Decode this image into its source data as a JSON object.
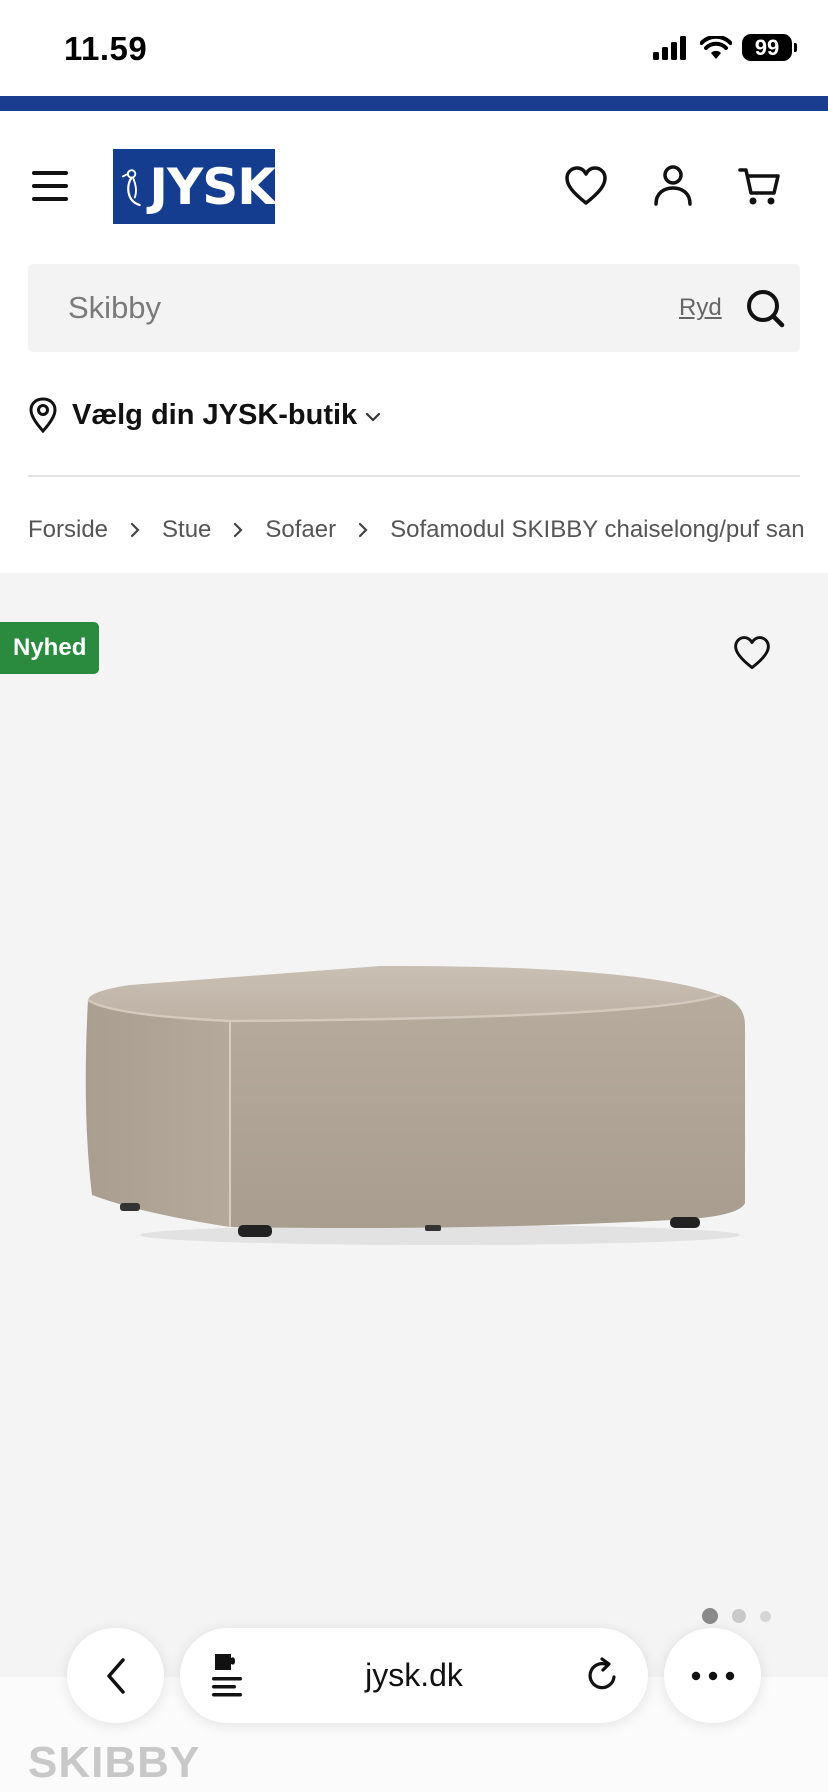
{
  "status_bar": {
    "time": "11.59",
    "battery": "99"
  },
  "header": {
    "logo_text": "JYSK"
  },
  "search": {
    "placeholder": "Skibby",
    "clear_label": "Ryd"
  },
  "store": {
    "label": "Vælg din JYSK-butik"
  },
  "breadcrumb": {
    "items": [
      "Forside",
      "Stue",
      "Sofaer",
      "Sofamodul SKIBBY chaiselong/puf san"
    ]
  },
  "gallery": {
    "badge": "Nyhed",
    "image_count": 3,
    "active_image": 1
  },
  "product": {
    "title": "SKIBBY"
  },
  "browser": {
    "url": "jysk.dk"
  },
  "colors": {
    "brand_blue": "#143d8f",
    "badge_green": "#2a8b3e"
  }
}
